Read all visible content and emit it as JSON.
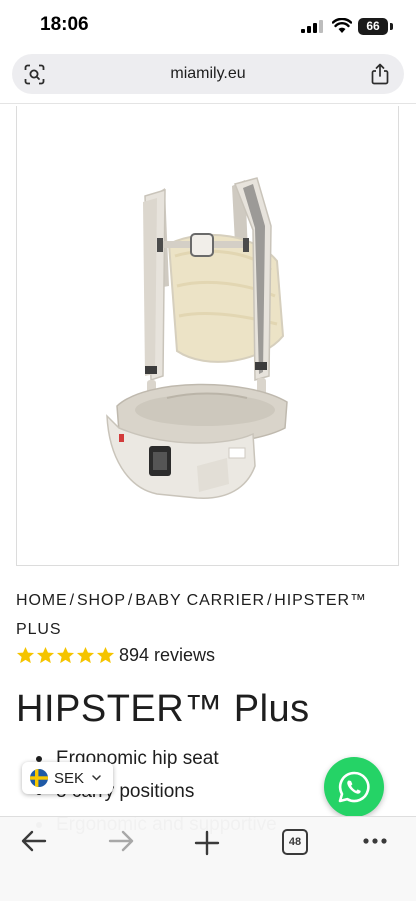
{
  "status_bar": {
    "time": "18:06",
    "battery": "66"
  },
  "browser": {
    "url": "miamily.eu",
    "tabs_count": "48"
  },
  "breadcrumb": [
    {
      "label": "HOME"
    },
    {
      "label": "SHOP"
    },
    {
      "label": "BABY CARRIER"
    },
    {
      "label": "HIPSTER™ PLUS"
    }
  ],
  "breadcrumb_separator": "/",
  "product": {
    "rating": 5,
    "reviews": "894 reviews",
    "title": "HIPSTER™ Plus",
    "features": [
      "Ergonomic hip seat",
      "8 carry positions",
      "Ergonomic and supportive"
    ]
  },
  "currency": {
    "flag": "sweden-flag-icon",
    "code": "SEK"
  },
  "colors": {
    "star": "#f5c400",
    "whatsapp": "#25d366",
    "carrier": "#e3ddd2"
  }
}
